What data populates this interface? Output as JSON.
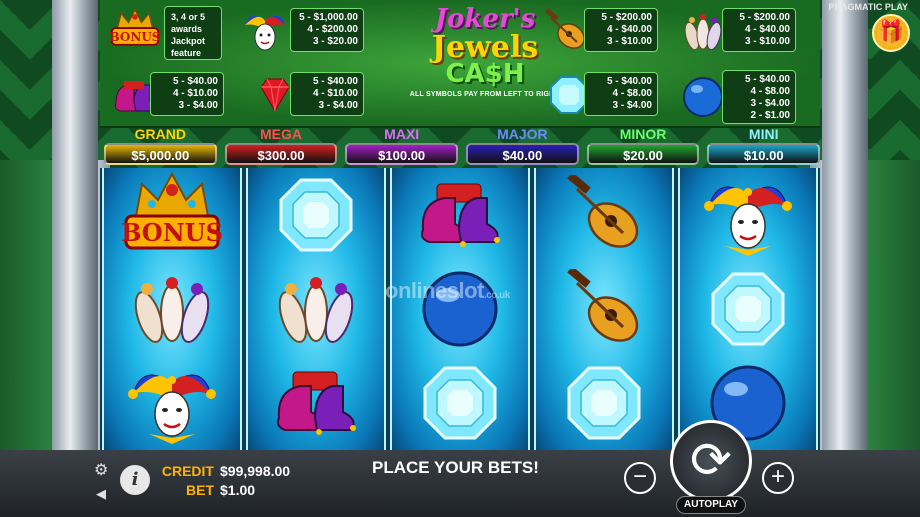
{
  "brand": "PRAGMATIC PLAY",
  "logo": {
    "line1": "Joker's",
    "line2": "Jewels",
    "line3": "CA$H",
    "tagline": "ALL SYMBOLS PAY FROM LEFT TO RIGHT."
  },
  "paytable": {
    "bonus": {
      "label": "BONUS",
      "text": [
        "3, 4 or 5",
        "awards",
        "Jackpot",
        "feature"
      ]
    },
    "joker": [
      "5 - $1,000.00",
      "4 - $200.00",
      "3 - $20.00"
    ],
    "shoes": [
      "5 - $40.00",
      "4 - $10.00",
      "3 - $4.00"
    ],
    "ruby": [
      "5 - $40.00",
      "4 - $10.00",
      "3 - $4.00"
    ],
    "lute": [
      "5 - $200.00",
      "4 - $40.00",
      "3 - $10.00"
    ],
    "pins": [
      "5 - $200.00",
      "4 - $40.00",
      "3 - $10.00"
    ],
    "diamond": [
      "5 - $40.00",
      "4 - $8.00",
      "3 - $4.00"
    ],
    "ball": [
      "5 - $40.00",
      "4 - $8.00",
      "3 - $4.00",
      "2 - $1.00"
    ]
  },
  "jackpots": [
    {
      "label": "GRAND",
      "value": "$5,000.00",
      "color": "#e8b800",
      "label_color": "#ffd400"
    },
    {
      "label": "MEGA",
      "value": "$300.00",
      "color": "#d42020",
      "label_color": "#ff5050"
    },
    {
      "label": "MAXI",
      "value": "$100.00",
      "color": "#a41fc8",
      "label_color": "#e06bff"
    },
    {
      "label": "MAJOR",
      "value": "$40.00",
      "color": "#2a1fb8",
      "label_color": "#6b8bff"
    },
    {
      "label": "MINOR",
      "value": "$20.00",
      "color": "#1fa82e",
      "label_color": "#6bff6b"
    },
    {
      "label": "MINI",
      "value": "$10.00",
      "color": "#1aa8c8",
      "label_color": "#8ff0ff"
    }
  ],
  "reels": [
    [
      "bonus-crown",
      "bowling-pins",
      "joker"
    ],
    [
      "diamond",
      "bowling-pins",
      "jester-shoes"
    ],
    [
      "jester-shoes",
      "blue-ball",
      "diamond"
    ],
    [
      "lute",
      "lute",
      "diamond"
    ],
    [
      "joker",
      "diamond",
      "blue-ball"
    ]
  ],
  "reel_bonus_label": "BONUS",
  "watermark": {
    "main": "onlineslot",
    "suffix": ".co.uk"
  },
  "footer": {
    "credit_label": "CREDIT",
    "credit_value": "$99,998.00",
    "bet_label": "BET",
    "bet_value": "$1.00",
    "message": "PLACE YOUR BETS!",
    "minus": "−",
    "plus": "+",
    "spin": "⟳",
    "autoplay": "AUTOPLAY",
    "info": "i",
    "gear": "⚙",
    "speaker": "◀"
  },
  "gift": "🎁"
}
